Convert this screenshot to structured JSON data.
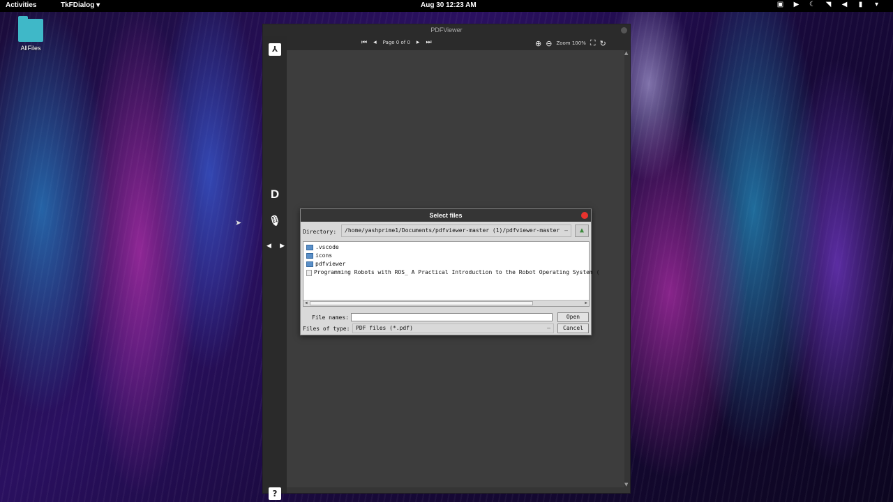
{
  "topbar": {
    "activities": "Activities",
    "app_menu": "TkFDialog ▾",
    "clock": "Aug 30  12:23 AM",
    "tray_icons": [
      "display-icon",
      "camera-icon",
      "night-mode-icon",
      "wifi-icon",
      "volume-icon",
      "battery-icon",
      "power-menu-icon"
    ]
  },
  "desktop": {
    "folder_label": "AllFiles",
    "folder_color": "#3fb8c8"
  },
  "pdfviewer": {
    "title": "PDFViewer",
    "page_indicator": "Page 0 of 0",
    "zoom_label": "Zoom 100%",
    "sidebar_d": "D",
    "help": "?"
  },
  "dialog": {
    "title": "Select files",
    "directory_label": "Directory:",
    "directory_value": "/home/yashprime1/Documents/pdfviewer-master (1)/pdfviewer-master",
    "files": [
      {
        "name": ".vscode",
        "type": "folder"
      },
      {
        "name": "icons",
        "type": "folder"
      },
      {
        "name": "pdfviewer",
        "type": "folder"
      },
      {
        "name": "Programming Robots with ROS_ A Practical Introduction to the Robot Operating System (",
        "type": "file"
      }
    ],
    "file_names_label": "File names:",
    "file_names_value": "",
    "files_of_type_label": "Files of type:",
    "files_of_type_value": "PDF files (*.pdf)",
    "open_label": "Open",
    "cancel_label": "Cancel",
    "close_color": "#e8332e"
  }
}
